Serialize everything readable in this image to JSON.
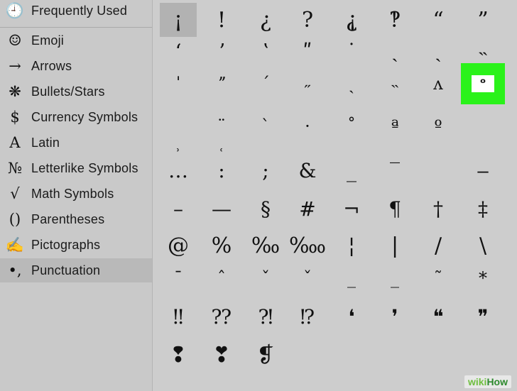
{
  "sidebar": {
    "items": [
      {
        "label": "Frequently Used",
        "icon": "clock-icon",
        "glyph": "🕘"
      },
      {
        "label": "Emoji",
        "icon": "smiley-icon",
        "glyph": "☺"
      },
      {
        "label": "Arrows",
        "icon": "arrow-icon",
        "glyph": "→"
      },
      {
        "label": "Bullets/Stars",
        "icon": "asterisk-icon",
        "glyph": "❋"
      },
      {
        "label": "Currency Symbols",
        "icon": "dollar-icon",
        "glyph": "$"
      },
      {
        "label": "Latin",
        "icon": "latin-a-icon",
        "glyph": "A"
      },
      {
        "label": "Letterlike Symbols",
        "icon": "numero-icon",
        "glyph": "№"
      },
      {
        "label": "Math Symbols",
        "icon": "square-root-icon",
        "glyph": "√"
      },
      {
        "label": "Parentheses",
        "icon": "parentheses-icon",
        "glyph": "()"
      },
      {
        "label": "Pictographs",
        "icon": "pencil-icon",
        "glyph": "✍"
      },
      {
        "label": "Punctuation",
        "icon": "punctuation-icon",
        "glyph": "•,"
      }
    ],
    "selected": "Punctuation"
  },
  "grid": {
    "rows": [
      [
        "¡",
        "!",
        "¿",
        "?",
        "⸘",
        "‽",
        "“",
        "”"
      ],
      [
        "ʻ",
        "ʼ",
        "ʽ",
        "ʺ",
        "˙",
        "ˏ",
        "ˎ",
        "˵"
      ],
      [
        "ˈ",
        "ˮ",
        "ˊ",
        "˶",
        "ˏ",
        "˵",
        "ʌ",
        "ᵒ"
      ],
      [
        "",
        "¨",
        "ˋ",
        "·",
        "˚",
        "ª",
        "º",
        ""
      ],
      [
        "˒",
        "˓",
        "",
        "",
        "",
        "",
        "",
        ""
      ],
      [
        "…",
        ":",
        ";",
        "&",
        "_",
        "‾",
        "",
        "‒"
      ],
      [
        "–",
        "—",
        "§",
        "#",
        "¬",
        "¶",
        "†",
        "‡"
      ],
      [
        "@",
        "%",
        "‰",
        "‱",
        "¦",
        "|",
        "/",
        "\\"
      ],
      [
        "ˉ",
        "ˆ",
        "ˇ",
        "ˇ",
        "_",
        "_",
        "˜",
        "*"
      ],
      [
        "‼",
        "⁇",
        "⁈",
        "⁉",
        "❛",
        "❜",
        "❝",
        "❞"
      ],
      [
        "❢",
        "❣",
        "❡",
        "",
        "",
        "",
        "",
        ""
      ]
    ],
    "selected_char": "¡",
    "highlighted_char": "ᵒ"
  },
  "watermark": {
    "prefix": "wiki",
    "suffix": "How"
  }
}
